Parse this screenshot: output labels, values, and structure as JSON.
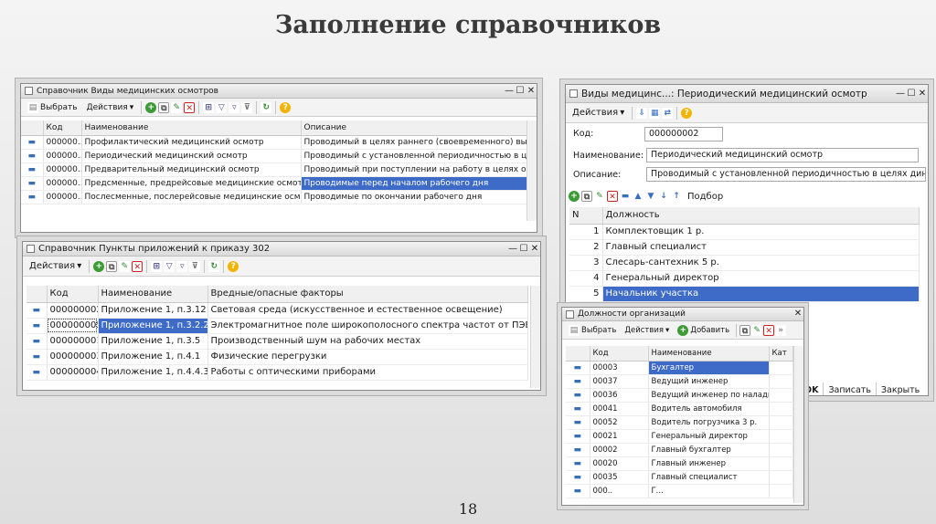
{
  "slide": {
    "title": "Заполнение справочников",
    "page_number": "18"
  },
  "win1": {
    "title": "Справочник Виды медицинских осмотров",
    "toolbar": {
      "select": "Выбрать",
      "actions": "Действия"
    },
    "columns": [
      "Код",
      "Наименование",
      "Описание"
    ],
    "rows": [
      {
        "code": "000000...",
        "name": "Профилактический медицинский осмотр",
        "desc": "Проводимый в целях раннего (своевременного) выявл..."
      },
      {
        "code": "000000...",
        "name": "Периодический медицинский осмотр",
        "desc": "Проводимый с установленной периодичностью в целя..."
      },
      {
        "code": "000000...",
        "name": "Предварительный медицинский осмотр",
        "desc": "Проводимый при поступлении на работу в целях опред..."
      },
      {
        "code": "000000...",
        "name": "Предсменные, предрейсовые медицинские осмотры",
        "desc": "Проводимые перед началом рабочего дня"
      },
      {
        "code": "000000...",
        "name": "Послесменные, послерейсовые медицинские осмотры",
        "desc": "Проводимые по окончании рабочего дня"
      }
    ]
  },
  "win2": {
    "title": "Справочник Пункты приложений к приказу 302",
    "toolbar": {
      "actions": "Действия"
    },
    "columns": [
      "Код",
      "Наименование",
      "Вредные/опасные факторы"
    ],
    "rows": [
      {
        "code": "000000002",
        "name": "Приложение 1, п.3.12",
        "factor": "Световая среда (искусственное и естественное освещение)"
      },
      {
        "code": "000000005",
        "name": "Приложение 1, п.3.2.2.4",
        "factor": "Электромагнитное поле широкополосного спектра частот от ПЭВМ (работа ..."
      },
      {
        "code": "000000001",
        "name": "Приложение 1, п.3.5",
        "factor": "Производственный шум на рабочих местах"
      },
      {
        "code": "000000003",
        "name": "Приложение 1, п.4.1",
        "factor": "Физические перегрузки"
      },
      {
        "code": "000000004",
        "name": "Приложение 1, п.4.4.3",
        "factor": "Работы с оптическими приборами"
      }
    ]
  },
  "win3": {
    "title": "Виды медицинс...: Периодический медицинский осмотр",
    "toolbar": {
      "actions": "Действия"
    },
    "code_label": "Код:",
    "code_value": "000000002",
    "name_label": "Наименование:",
    "name_value": "Периодический медицинский осмотр",
    "desc_label": "Описание:",
    "desc_value": "Проводимый с установленной периодичностью в целях динам",
    "select_label": "Подбор",
    "columns": [
      "N",
      "Должность"
    ],
    "rows": [
      {
        "n": "1",
        "pos": "Комплектовщик 1 р."
      },
      {
        "n": "2",
        "pos": "Главный специалист"
      },
      {
        "n": "3",
        "pos": "Слесарь-сантехник 5 р."
      },
      {
        "n": "4",
        "pos": "Генеральный директор"
      },
      {
        "n": "5",
        "pos": "Начальник участка"
      }
    ],
    "buttons": {
      "ok": "OK",
      "save": "Записать",
      "close": "Закрыть"
    }
  },
  "win4": {
    "title": "Должности организаций",
    "toolbar": {
      "select": "Выбрать",
      "actions": "Действия",
      "add": "Добавить"
    },
    "columns": [
      "Код",
      "Наименование",
      "Кат"
    ],
    "rows": [
      {
        "code": "00003",
        "name": "Бухгалтер"
      },
      {
        "code": "00037",
        "name": "Ведущий инженер"
      },
      {
        "code": "00036",
        "name": "Ведущий инженер по наладк..."
      },
      {
        "code": "00041",
        "name": "Водитель автомобиля"
      },
      {
        "code": "00052",
        "name": "Водитель погрузчика 3 р."
      },
      {
        "code": "00021",
        "name": "Генеральный директор"
      },
      {
        "code": "00002",
        "name": "Главный бухгалтер"
      },
      {
        "code": "00020",
        "name": "Главный инженер"
      },
      {
        "code": "00035",
        "name": "Главный специалист"
      },
      {
        "code": "000..",
        "name": "Г..."
      }
    ]
  },
  "colors": {
    "selection": "#3d6bc7",
    "toolbar_bg": "#f3f3f3",
    "title_text": "#3a3a3a"
  },
  "icons": [
    "table-icon",
    "add-icon",
    "copy-icon",
    "edit-icon",
    "delete-icon",
    "filter-icon",
    "refresh-icon",
    "help-icon",
    "move-up-icon",
    "move-down-icon",
    "sort-icon"
  ]
}
